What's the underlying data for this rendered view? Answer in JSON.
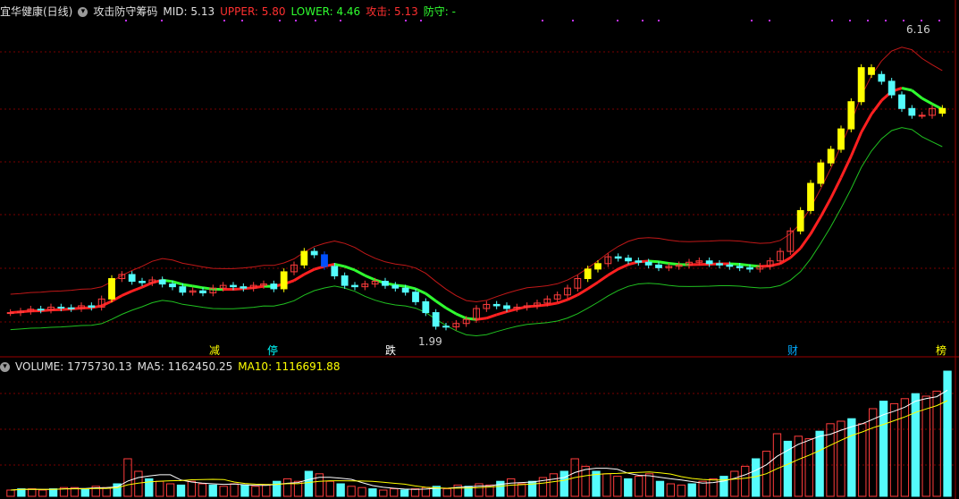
{
  "header": {
    "stock_name": "宜华健康(日线)",
    "indicator_name": "攻击防守筹码",
    "mid": "MID: 5.13",
    "upper": "UPPER: 5.80",
    "lower": "LOWER: 4.46",
    "attack": "攻击: 5.13",
    "defense": "防守: -"
  },
  "volume_header": {
    "volume": "VOLUME: 1775730.13",
    "ma5": "MA5: 1162450.25",
    "ma10": "MA10: 1116691.88"
  },
  "signals": [
    {
      "label": "减",
      "color": "#ffff00"
    },
    {
      "label": "停",
      "color": "#00ffff"
    },
    {
      "label": "跌",
      "color": "#ffffff"
    },
    {
      "label": "财",
      "color": "#00aaff"
    },
    {
      "label": "榜",
      "color": "#ffff00"
    }
  ],
  "annotations": {
    "high_label": "6.16",
    "low_label": "1.99"
  },
  "colors": {
    "up": "#ff3c3c",
    "down": "#54fcfc",
    "highlight": "#ffff00",
    "blue_bar": "#0050ff",
    "mid_line": "#ff2020",
    "upper_line": "#c01818",
    "lower_line": "#20c020",
    "attack_line": "#30ff30",
    "grid": "#7a0000",
    "ma5": "#ffffff",
    "ma10": "#ffff00"
  },
  "chart_data": {
    "type": "candlestick",
    "price_close_series": [
      2.2,
      2.22,
      2.25,
      2.24,
      2.28,
      2.27,
      2.26,
      2.3,
      2.28,
      2.4,
      2.7,
      2.76,
      2.66,
      2.64,
      2.68,
      2.62,
      2.58,
      2.5,
      2.52,
      2.49,
      2.56,
      2.6,
      2.58,
      2.56,
      2.6,
      2.62,
      2.55,
      2.8,
      2.9,
      3.1,
      3.05,
      2.88,
      2.74,
      2.6,
      2.58,
      2.62,
      2.66,
      2.6,
      2.56,
      2.5,
      2.36,
      2.2,
      2.0,
      1.99,
      2.04,
      2.1,
      2.26,
      2.32,
      2.3,
      2.26,
      2.28,
      2.3,
      2.34,
      2.4,
      2.46,
      2.56,
      2.7,
      2.84,
      2.92,
      3.02,
      3.0,
      2.96,
      2.94,
      2.9,
      2.86,
      2.88,
      2.9,
      2.94,
      2.96,
      2.92,
      2.9,
      2.88,
      2.86,
      2.84,
      2.88,
      2.96,
      3.1,
      3.4,
      3.7,
      4.1,
      4.4,
      4.6,
      4.9,
      5.3,
      5.8,
      5.7,
      5.6,
      5.4,
      5.2,
      5.1,
      5.1,
      5.2,
      5.13
    ],
    "mid_series": [
      2.3,
      2.32,
      2.34,
      2.36,
      2.38,
      2.4,
      2.42,
      2.46,
      2.5,
      2.52,
      2.55,
      2.58,
      2.6,
      2.62,
      2.62,
      2.62,
      2.6,
      2.56,
      2.5,
      2.42,
      2.34,
      2.26,
      2.18,
      2.1,
      2.04,
      2.0,
      2.0,
      2.04,
      2.1,
      2.2,
      2.32,
      2.44,
      2.56,
      2.66,
      2.72,
      2.76,
      2.8,
      2.84,
      2.86,
      2.88,
      2.9,
      2.9,
      3.0,
      3.2,
      3.5,
      3.9,
      4.3,
      4.7,
      5.13
    ],
    "volume_values": [
      5,
      6,
      6,
      5,
      6,
      7,
      7,
      6,
      8,
      7,
      10,
      30,
      20,
      14,
      12,
      10,
      9,
      12,
      10,
      9,
      8,
      10,
      9,
      8,
      9,
      12,
      14,
      12,
      20,
      18,
      12,
      10,
      8,
      7,
      6,
      5,
      6,
      5,
      6,
      7,
      8,
      6,
      9,
      8,
      10,
      9,
      12,
      14,
      10,
      12,
      15,
      18,
      20,
      30,
      24,
      20,
      18,
      16,
      14,
      16,
      18,
      12,
      10,
      9,
      10,
      12,
      14,
      16,
      20,
      24,
      30,
      36,
      50,
      44,
      48,
      46,
      52,
      58,
      60,
      62,
      58,
      70,
      76,
      74,
      78,
      82,
      80,
      84,
      100
    ],
    "ma5_note": "MA5",
    "ma10_note": "MA10"
  }
}
